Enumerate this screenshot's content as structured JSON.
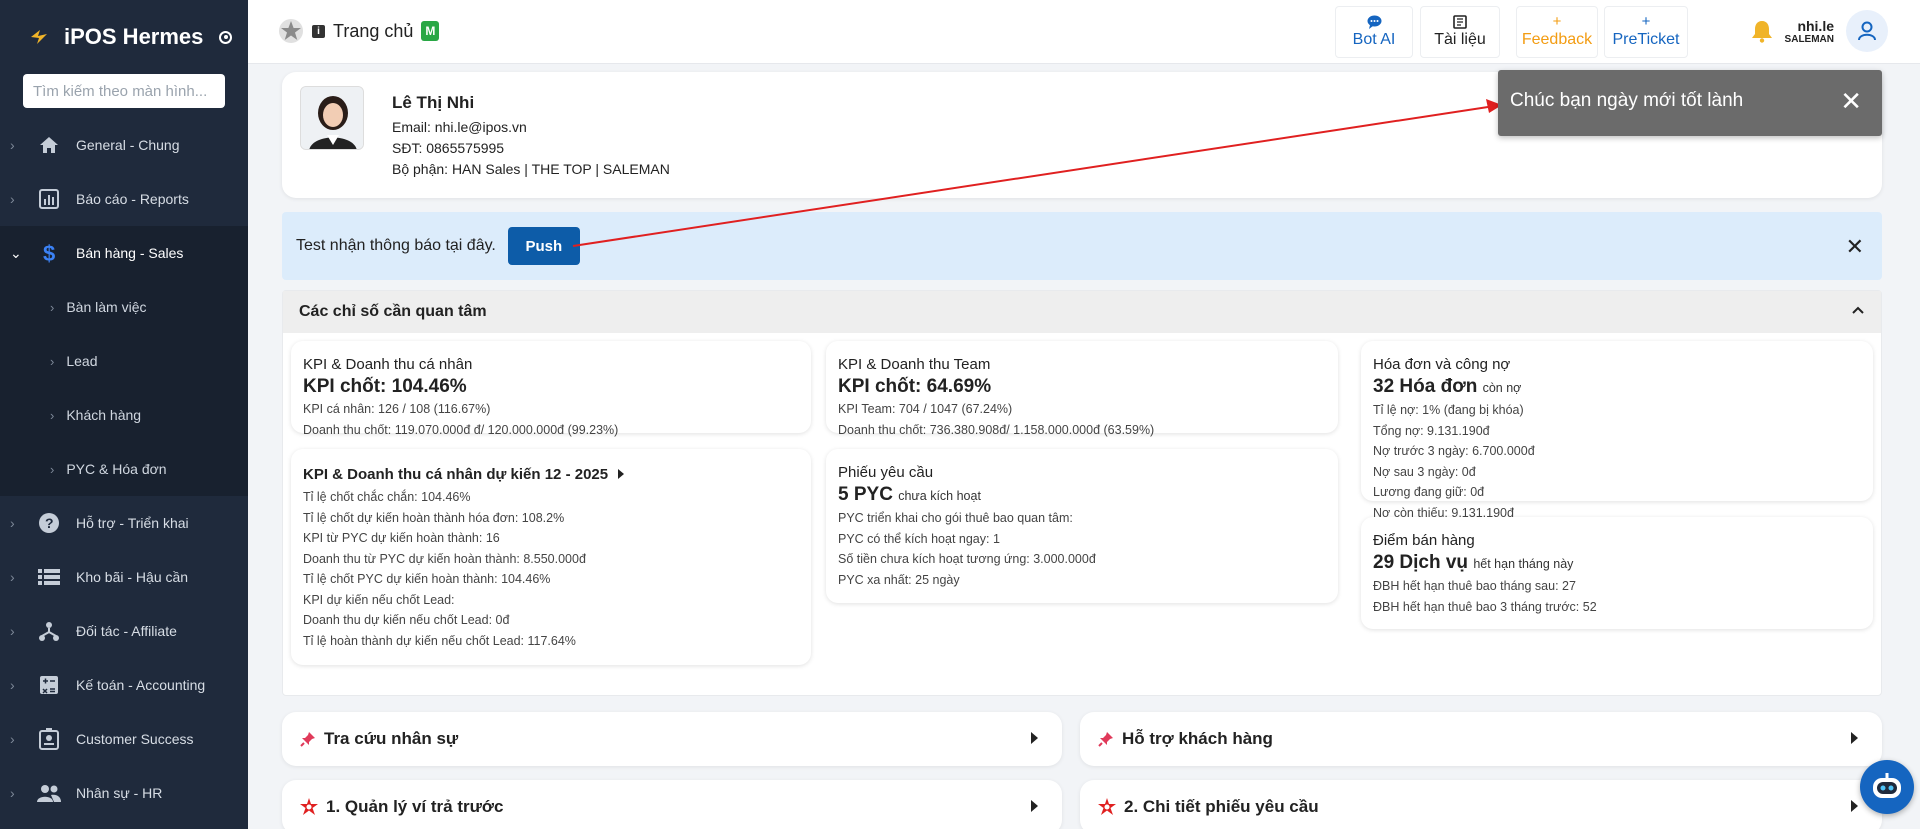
{
  "app": {
    "name": "iPOS Hermes",
    "search_placeholder": "Tìm kiếm theo màn hình..."
  },
  "sidebar": {
    "items": [
      {
        "label": "General - Chung",
        "icon": "home-icon"
      },
      {
        "label": "Báo cáo - Reports",
        "icon": "chart-icon"
      },
      {
        "label": "Bán hàng - Sales",
        "icon": "dollar-icon",
        "active": true
      },
      {
        "label": "Hỗ trợ - Triển khai",
        "icon": "help-icon"
      },
      {
        "label": "Kho bãi - Hậu cần",
        "icon": "list-icon"
      },
      {
        "label": "Đối tác - Affiliate",
        "icon": "network-icon"
      },
      {
        "label": "Kế toán - Accounting",
        "icon": "calculator-icon"
      },
      {
        "label": "Customer Success",
        "icon": "badge-icon"
      },
      {
        "label": "Nhân sự - HR",
        "icon": "people-icon"
      }
    ],
    "sub_items": [
      "Bàn làm việc",
      "Lead",
      "Khách hàng",
      "PYC & Hóa đơn"
    ]
  },
  "header": {
    "breadcrumb": "Trang chủ",
    "badge": "M",
    "buttons": [
      {
        "label": "Bot AI",
        "icon": "chat-icon",
        "color": "#1565c0"
      },
      {
        "label": "Tài liệu",
        "icon": "book-icon",
        "color": "#222222"
      },
      {
        "label": "Feedback",
        "icon": "plus-icon",
        "color": "#f39c12"
      },
      {
        "label": "PreTicket",
        "icon": "plus-icon",
        "color": "#1565c0"
      }
    ],
    "user": {
      "name": "nhi.le",
      "role": "SALEMAN"
    }
  },
  "profile": {
    "name": "Lê Thị Nhi",
    "email": "Email: nhi.le@ipos.vn",
    "phone": "SĐT: 0865575995",
    "department": "Bộ phận: HAN Sales | THE TOP | SALEMAN"
  },
  "notice": {
    "text": "Test nhận thông báo tại đây.",
    "button": "Push"
  },
  "toast": {
    "text": "Chúc bạn ngày mới tốt lành"
  },
  "kpi_section": {
    "title": "Các chỉ số cần quan tâm",
    "personal": {
      "title": "KPI & Doanh thu cá nhân",
      "big": "KPI chốt: 104.46%",
      "lines": [
        "KPI cá nhân: 126 / 108 (116.67%)",
        "Doanh thu chốt: 119.070.000đ đ/ 120.000.000đ (99.23%)"
      ]
    },
    "team": {
      "title": "KPI & Doanh thu Team",
      "big": "KPI chốt: 64.69%",
      "lines": [
        "KPI Team: 704 / 1047 (67.24%)",
        "Doanh thu chốt: 736.380.908đ/ 1.158.000.000đ (63.59%)"
      ]
    },
    "invoice": {
      "title": "Hóa đơn và công nợ",
      "big": "32 Hóa đơn",
      "big_suffix": "còn nợ",
      "lines": [
        "Tỉ lệ nợ: 1% (đang bị khóa)",
        "Tổng nợ: 9.131.190đ",
        "Nợ trước 3 ngày: 6.700.000đ",
        "Nợ sau 3 ngày: 0đ",
        "Lương đang giữ: 0đ",
        "Nợ còn thiếu: 9.131.190đ"
      ]
    },
    "forecast": {
      "title": "KPI & Doanh thu cá nhân dự kiến 12 - 2025",
      "lines": [
        "Tỉ lệ chốt chắc chắn: 104.46%",
        "Tỉ lệ chốt dự kiến hoàn thành hóa đơn: 108.2%",
        "KPI từ PYC dự kiến hoàn thành: 16",
        "Doanh thu từ PYC dự kiến hoàn thành: 8.550.000đ",
        "Tỉ lệ chốt PYC dự kiến hoàn thành: 104.46%",
        "KPI dự kiến nếu chốt Lead:",
        "Doanh thu dự kiến nếu chốt Lead: 0đ",
        "Tỉ lệ hoàn thành dự kiến nếu chốt Lead: 117.64%"
      ]
    },
    "requests": {
      "title": "Phiếu yêu cầu",
      "big": "5 PYC",
      "big_suffix": "chưa kích hoạt",
      "lines": [
        "PYC triển khai cho gói thuê bao quan tâm:",
        "PYC có thể kích hoạt ngay: 1",
        "Số tiền chưa kích hoạt tương ứng: 3.000.000đ",
        "PYC xa nhất: 25 ngày"
      ]
    },
    "sales_points": {
      "title": "Điểm bán hàng",
      "big": "29 Dịch vụ",
      "big_suffix": "hết hạn tháng này",
      "lines": [
        "ĐBH hết hạn thuê bao tháng sau: 27",
        "ĐBH hết hạn thuê bao 3 tháng trước: 52"
      ]
    }
  },
  "links": [
    {
      "label": "Tra cứu nhân sự",
      "icon": "pin-icon"
    },
    {
      "label": "Hỗ trợ khách hàng",
      "icon": "pin-icon"
    },
    {
      "label": "1. Quản lý ví trả trước",
      "icon": "star-icon"
    },
    {
      "label": "2. Chi tiết phiếu yêu cầu",
      "icon": "star-icon"
    }
  ],
  "colors": {
    "sidebar": "#1f2a3c",
    "primary": "#0d5ca8",
    "notice_bg": "#dcecfb",
    "toast_bg": "#6b6b6b",
    "arrow": "#e02020"
  }
}
